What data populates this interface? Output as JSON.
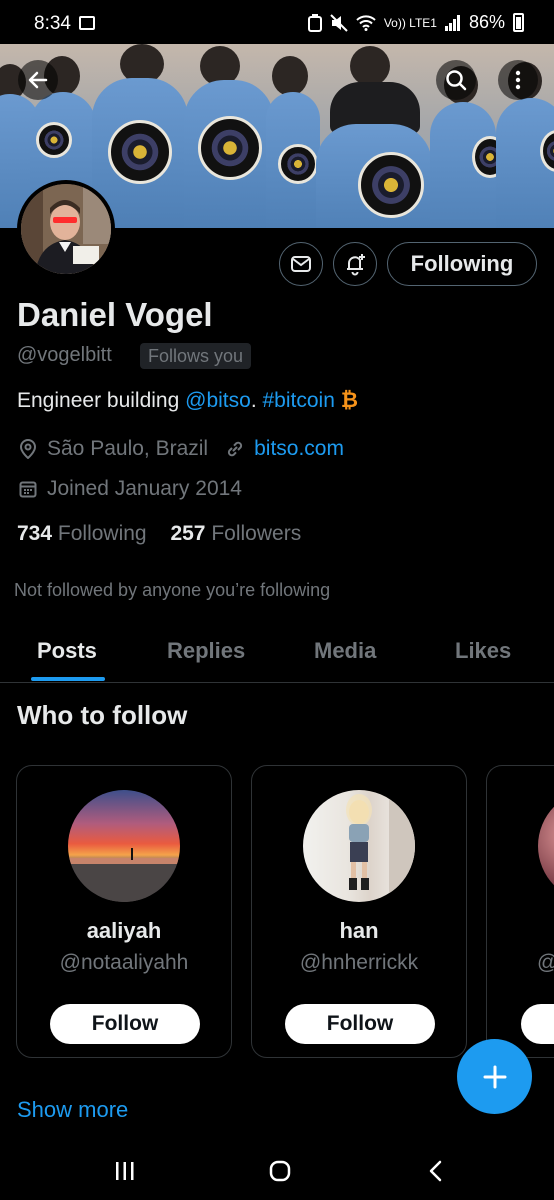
{
  "status_bar": {
    "time": "8:34",
    "network": "Vo)) LTE1",
    "battery_percent": "86%",
    "icons": [
      "gallery-icon",
      "data-saver-icon",
      "mute-icon",
      "wifi-icon",
      "signal-icon",
      "battery-icon"
    ]
  },
  "banner": {
    "buttons": [
      "back-arrow-icon",
      "search-icon",
      "more-vertical-icon"
    ]
  },
  "profile": {
    "display_name": "Daniel Vogel",
    "handle": "@vogelbitt",
    "follows_you": "Follows you",
    "following_button": "Following",
    "bio_text": "Engineer building ",
    "bio_mention": "@bitso",
    "bio_sep": ". ",
    "bio_hashtag": "#bitcoin",
    "bio_emoji": "₿",
    "location": "São Paulo, Brazil",
    "website": "bitso.com",
    "joined": "Joined January 2014",
    "following_count": "734",
    "following_label": "Following",
    "followers_count": "257",
    "followers_label": "Followers",
    "mutuals_note": "Not followed by anyone you’re following"
  },
  "tabs": [
    {
      "label": "Posts",
      "active": true
    },
    {
      "label": "Replies",
      "active": false
    },
    {
      "label": "Media",
      "active": false
    },
    {
      "label": "Likes",
      "active": false
    }
  ],
  "who_to_follow": {
    "title": "Who to follow",
    "cards": [
      {
        "name": "aaliyah",
        "handle": "@notaaliyahh",
        "button": "Follow"
      },
      {
        "name": "han",
        "handle": "@hnherrickk",
        "button": "Follow"
      }
    ],
    "partial_card_handle": "@",
    "show_more": "Show more"
  },
  "colors": {
    "accent": "#1d9bf0",
    "background": "#000000",
    "text_primary": "#e7e9ea",
    "text_secondary": "#71767b",
    "bitcoin_orange": "#f7931a"
  }
}
